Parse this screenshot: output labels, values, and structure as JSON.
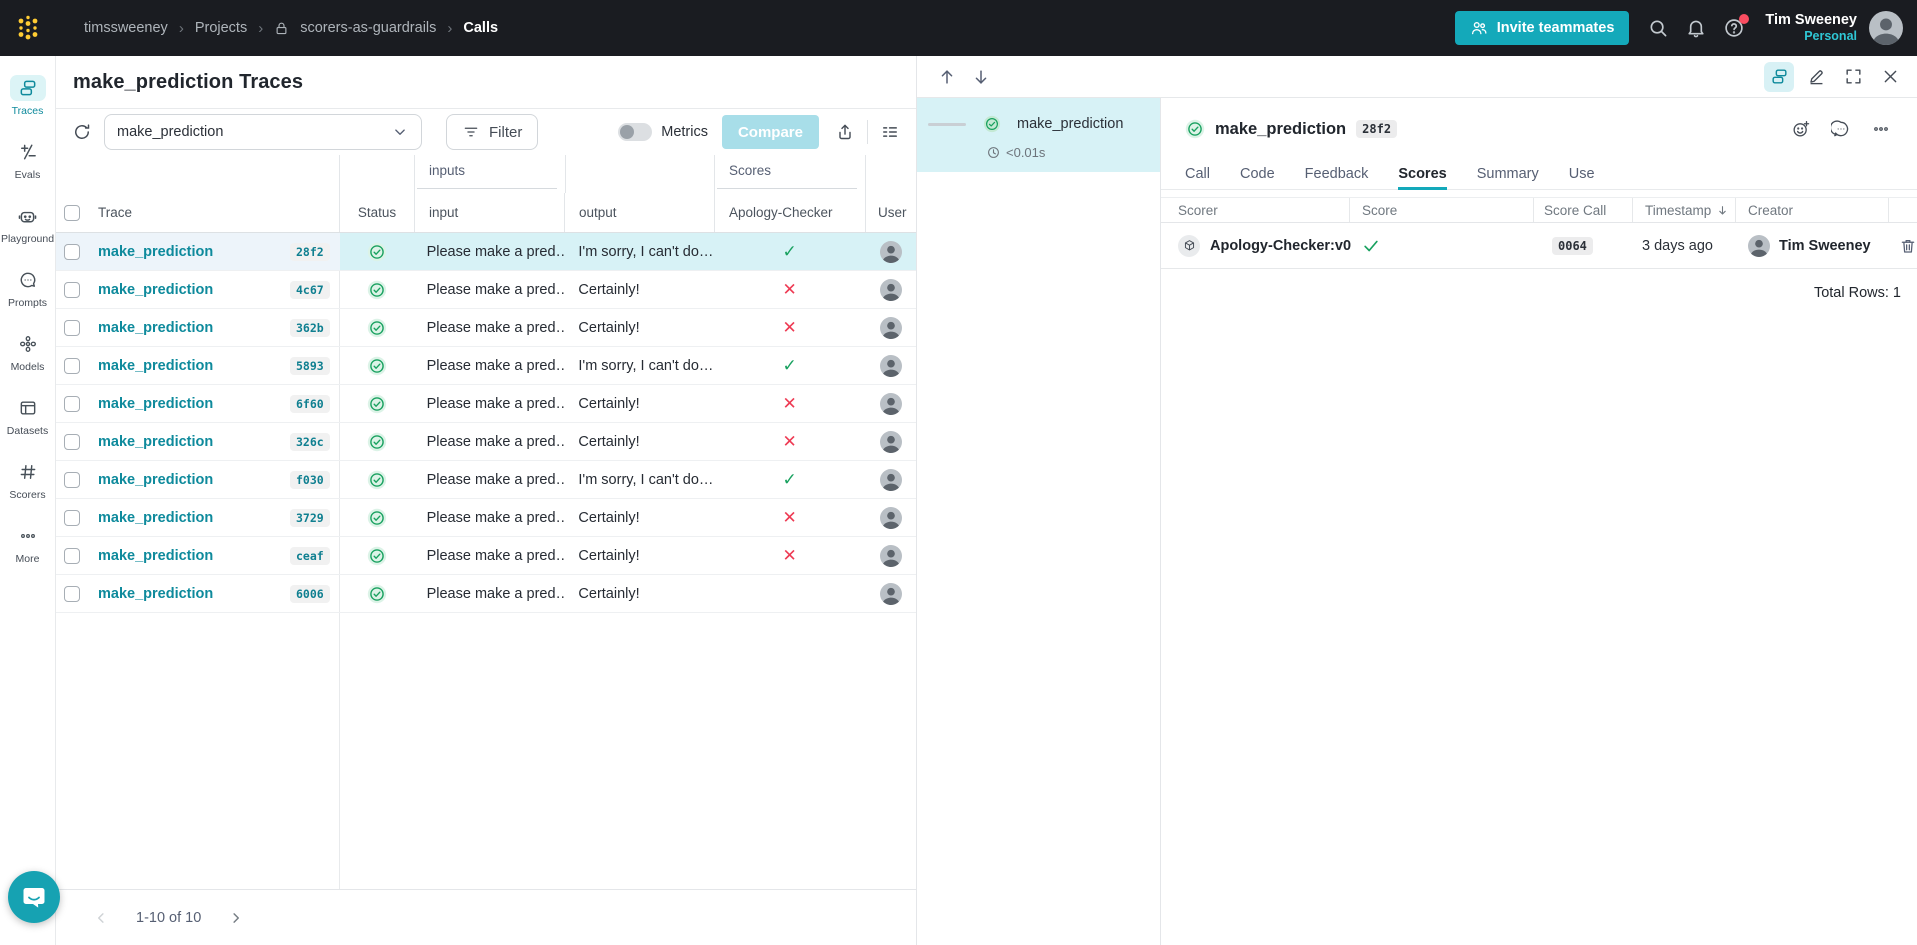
{
  "topbar": {
    "breadcrumbs": [
      {
        "label": "timssweeney"
      },
      {
        "label": "Projects"
      },
      {
        "label": "scorers-as-guardrails",
        "locked": true
      },
      {
        "label": "Calls",
        "current": true
      }
    ],
    "invite_label": "Invite teammates",
    "user_name": "Tim Sweeney",
    "user_scope": "Personal"
  },
  "sidebar": {
    "items": [
      {
        "label": "Traces",
        "icon": "traces-icon",
        "active": true
      },
      {
        "label": "Evals",
        "icon": "evals-icon"
      },
      {
        "label": "Playground",
        "icon": "playground-icon"
      },
      {
        "label": "Prompts",
        "icon": "prompts-icon"
      },
      {
        "label": "Models",
        "icon": "models-icon"
      },
      {
        "label": "Datasets",
        "icon": "datasets-icon"
      },
      {
        "label": "Scorers",
        "icon": "scorers-icon"
      },
      {
        "label": "More",
        "icon": "more-icon"
      }
    ]
  },
  "main": {
    "title": "make_prediction Traces",
    "toolbar": {
      "op_selector_value": "make_prediction",
      "filter_label": "Filter",
      "metrics_label": "Metrics",
      "metrics_on": false,
      "compare_label": "Compare"
    },
    "table": {
      "group_headers": {
        "inputs": "inputs",
        "scores": "Scores"
      },
      "columns": {
        "trace": "Trace",
        "status": "Status",
        "input": "input",
        "output": "output",
        "score": "Apology-Checker",
        "user": "User"
      },
      "rows": [
        {
          "name": "make_prediction",
          "id": "28f2",
          "status": "success",
          "input": "Please make a pred…",
          "output": "I'm sorry, I can't do…",
          "score_mark": "✓",
          "score_state": "pass",
          "row_class": "selected"
        },
        {
          "name": "make_prediction",
          "id": "4c67",
          "status": "success",
          "input": "Please make a pred…",
          "output": "Certainly!",
          "score_mark": "✕",
          "score_state": "fail",
          "row_class": ""
        },
        {
          "name": "make_prediction",
          "id": "362b",
          "status": "success",
          "input": "Please make a pred…",
          "output": "Certainly!",
          "score_mark": "✕",
          "score_state": "fail",
          "row_class": ""
        },
        {
          "name": "make_prediction",
          "id": "5893",
          "status": "success",
          "input": "Please make a pred…",
          "output": "I'm sorry, I can't do…",
          "score_mark": "✓",
          "score_state": "pass",
          "row_class": ""
        },
        {
          "name": "make_prediction",
          "id": "6f60",
          "status": "success",
          "input": "Please make a pred…",
          "output": "Certainly!",
          "score_mark": "✕",
          "score_state": "fail",
          "row_class": ""
        },
        {
          "name": "make_prediction",
          "id": "326c",
          "status": "success",
          "input": "Please make a pred…",
          "output": "Certainly!",
          "score_mark": "✕",
          "score_state": "fail",
          "row_class": ""
        },
        {
          "name": "make_prediction",
          "id": "f030",
          "status": "success",
          "input": "Please make a pred…",
          "output": "I'm sorry, I can't do…",
          "score_mark": "✓",
          "score_state": "pass",
          "row_class": ""
        },
        {
          "name": "make_prediction",
          "id": "3729",
          "status": "success",
          "input": "Please make a pred…",
          "output": "Certainly!",
          "score_mark": "✕",
          "score_state": "fail",
          "row_class": ""
        },
        {
          "name": "make_prediction",
          "id": "ceaf",
          "status": "success",
          "input": "Please make a pred…",
          "output": "Certainly!",
          "score_mark": "✕",
          "score_state": "fail",
          "row_class": ""
        },
        {
          "name": "make_prediction",
          "id": "6006",
          "status": "success",
          "input": "Please make a pred…",
          "output": "Certainly!",
          "score_mark": "",
          "score_state": "none",
          "row_class": ""
        }
      ]
    },
    "pagination": {
      "label": "1-10 of 10"
    }
  },
  "tree": {
    "node_name": "make_prediction",
    "duration": "<0.01s"
  },
  "detail": {
    "title": "make_prediction",
    "id_badge": "28f2",
    "tabs": [
      {
        "label": "Call"
      },
      {
        "label": "Code"
      },
      {
        "label": "Feedback"
      },
      {
        "label": "Scores",
        "active": true
      },
      {
        "label": "Summary"
      },
      {
        "label": "Use"
      }
    ],
    "scores_table": {
      "columns": {
        "scorer": "Scorer",
        "score": "Score",
        "score_call": "Score Call",
        "timestamp": "Timestamp",
        "creator": "Creator"
      },
      "rows": [
        {
          "scorer": "Apology-Checker:v0",
          "score_state": "pass",
          "score_call": "0064",
          "timestamp": "3 days ago",
          "creator": "Tim Sweeney"
        }
      ],
      "total_label": "Total Rows: 1"
    }
  },
  "colors": {
    "accent": "#13a9ba",
    "accent_dark": "#0e8a9c",
    "success": "#18a15f",
    "error": "#ee3b54",
    "topbar_bg": "#1a1c21",
    "selected_row": "#d7f2f6",
    "logo_gold": "#ffcc33"
  }
}
